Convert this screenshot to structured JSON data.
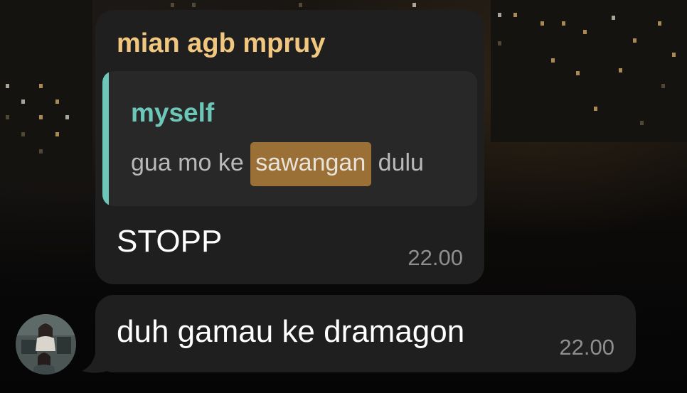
{
  "chat": {
    "messages": [
      {
        "sender_name": "mian agb mpruy",
        "reply": {
          "author": "myself",
          "text_before": "gua mo ke ",
          "highlight": "sawangan",
          "text_after": " dulu"
        },
        "text": "STOPP",
        "time": "22.00"
      },
      {
        "text": "duh gamau ke dramagon",
        "time": "22.00"
      }
    ]
  },
  "colors": {
    "bubble": "#1f1f1f",
    "sender_name": "#f1c77f",
    "quote_accent": "#6cc7b8",
    "highlight": "#9a7036",
    "timestamp": "#8f8f8f"
  },
  "icons": {
    "avatar": "sender-avatar-photo"
  }
}
